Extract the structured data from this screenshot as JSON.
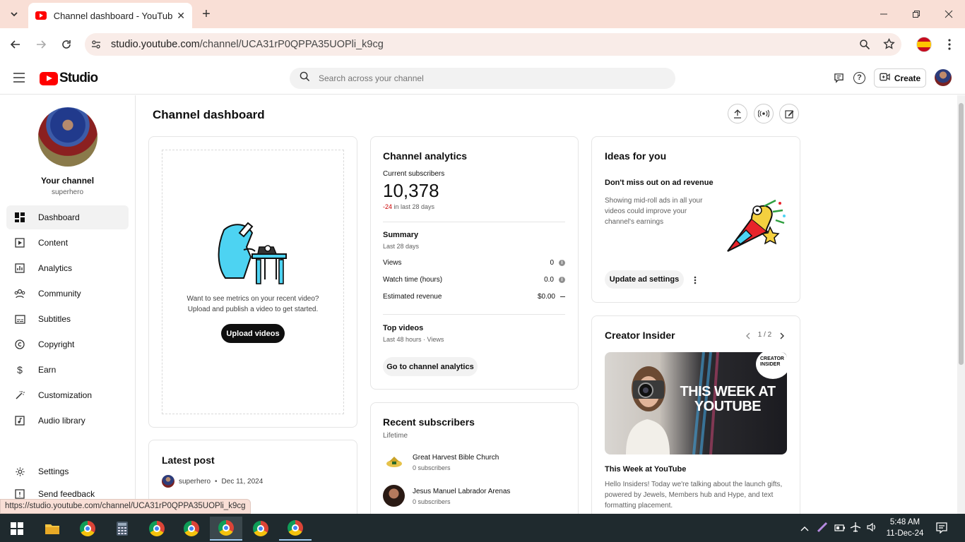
{
  "browser": {
    "tab_title": "Channel dashboard - YouTube Studio",
    "url_host": "studio.youtube.com",
    "url_path": "/channel/UCA31rP0QPPA35UOPli_k9cg",
    "status_url": "https://studio.youtube.com/channel/UCA31rP0QPPA35UOPli_k9cg"
  },
  "header": {
    "logo_text": "Studio",
    "search_placeholder": "Search across your channel",
    "create_label": "Create"
  },
  "sidebar": {
    "channel_title": "Your channel",
    "channel_handle": "superhero",
    "items": [
      {
        "label": "Dashboard",
        "icon": "dashboard-icon"
      },
      {
        "label": "Content",
        "icon": "content-icon"
      },
      {
        "label": "Analytics",
        "icon": "analytics-icon"
      },
      {
        "label": "Community",
        "icon": "community-icon"
      },
      {
        "label": "Subtitles",
        "icon": "subtitles-icon"
      },
      {
        "label": "Copyright",
        "icon": "copyright-icon"
      },
      {
        "label": "Earn",
        "icon": "earn-icon"
      },
      {
        "label": "Customization",
        "icon": "customization-icon"
      },
      {
        "label": "Audio library",
        "icon": "audio-library-icon"
      }
    ],
    "settings_label": "Settings",
    "feedback_label": "Send feedback"
  },
  "main": {
    "page_title": "Channel dashboard",
    "upload_card": {
      "line1": "Want to see metrics on your recent video?",
      "line2": "Upload and publish a video to get started.",
      "button": "Upload videos"
    },
    "latest_post": {
      "title": "Latest post",
      "author": "superhero",
      "date": "Dec 11, 2024"
    },
    "analytics": {
      "title": "Channel analytics",
      "subs_label": "Current subscribers",
      "subs_value": "10,378",
      "subs_delta": "-24",
      "subs_delta_suffix": " in last 28 days",
      "summary_title": "Summary",
      "summary_period": "Last 28 days",
      "rows": [
        {
          "label": "Views",
          "value": "0"
        },
        {
          "label": "Watch time (hours)",
          "value": "0.0"
        },
        {
          "label": "Estimated revenue",
          "value": "$0.00"
        }
      ],
      "top_videos_title": "Top videos",
      "top_videos_period": "Last 48 hours · Views",
      "button": "Go to channel analytics"
    },
    "recent_subs": {
      "title": "Recent subscribers",
      "period": "Lifetime",
      "items": [
        {
          "name": "Great Harvest Bible Church",
          "subs": "0 subscribers"
        },
        {
          "name": "Jesus Manuel Labrador Arenas",
          "subs": "0 subscribers"
        }
      ]
    },
    "ideas": {
      "title": "Ideas for you",
      "heading": "Don't miss out on ad revenue",
      "body": "Showing mid-roll ads in all your videos could improve your channel's earnings",
      "button": "Update ad settings"
    },
    "insider": {
      "title": "Creator Insider",
      "pager": "1 / 2",
      "thumb_text": "THIS WEEK AT YOUTUBE",
      "badge": "CREATOR INSIDER",
      "video_title": "This Week at YouTube",
      "body": "Hello Insiders! Today we're talking about the launch gifts, powered by Jewels, Members hub and Hype, and text formatting placement."
    }
  },
  "taskbar": {
    "time": "5:48 AM",
    "date": "11-Dec-24"
  },
  "colors": {
    "tabstrip": "#f9dfd6",
    "youtube_red": "#ff0000",
    "negative": "#cc0000",
    "taskbar": "#1f2a2e"
  }
}
